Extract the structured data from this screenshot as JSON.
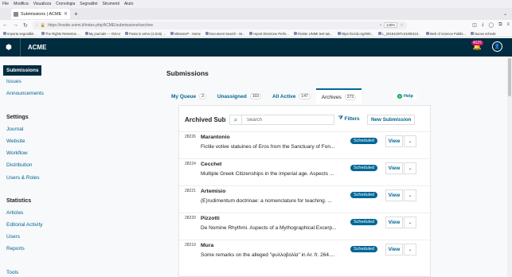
{
  "browser": {
    "menu": [
      "File",
      "Modifica",
      "Visualizza",
      "Cronologia",
      "Segnalibri",
      "Strumenti",
      "Aiuto"
    ],
    "tab_title": "Submissions | ACME",
    "url": "https://inside.unimi.it/index.php/ACME/submissions#archive",
    "zoom": "140%",
    "bookmarks": [
      "Importa segnalibri...",
      "The Rights Retention ...",
      "My journals — OOAJ",
      "Posta in arrivo (2.515) ...",
      "MilanoUP - Home",
      "Document Search - W...",
      "report Direzione Perfo...",
      "Riviste UNIMI test tas...",
      "https://orcid.org/000...",
      "L_2018119ITL01000110...",
      "Web of Science Publis...",
      "Nuove schede"
    ]
  },
  "header": {
    "context": "ACME",
    "notification_count": "4025"
  },
  "sidebar": {
    "submissions": "Submissions",
    "issues": "Issues",
    "announcements": "Announcements",
    "settings_head": "Settings",
    "journal": "Journal",
    "website": "Website",
    "workflow": "Workflow",
    "distribution": "Distribution",
    "users_roles": "Users & Roles",
    "statistics_head": "Statistics",
    "articles": "Articles",
    "editorial_activity": "Editorial Activity",
    "users": "Users",
    "reports": "Reports",
    "tools": "Tools"
  },
  "main": {
    "page_title": "Submissions",
    "tabs": [
      {
        "label": "My Queue",
        "count": "3"
      },
      {
        "label": "Unassigned",
        "count": "103"
      },
      {
        "label": "All Active",
        "count": "147"
      },
      {
        "label": "Archives",
        "count": "273"
      }
    ],
    "help_label": "Help",
    "list_title": "Archived Submissions",
    "search_placeholder": "Search",
    "filters_label": "Filters",
    "new_submission_label": "New Submission",
    "rows": [
      {
        "id": "28226",
        "author": "Marantonio",
        "title": "Fictile votive statuines of Eros from the Sanctuary of Fon...",
        "status": "Scheduled",
        "view": "View"
      },
      {
        "id": "28224",
        "author": "Cecchet",
        "title": "Multiple Greek Citizenships in the imperial age. Aspects ...",
        "status": "Scheduled",
        "view": "View"
      },
      {
        "id": "28221",
        "author": "Artemisio",
        "title": "(E)rudimentum doctrinae: a nomenclature for teaching. ...",
        "status": "Scheduled",
        "view": "View"
      },
      {
        "id": "28220",
        "author": "Pizzotti",
        "title": "De Nomine Rhythmi. Aspects of a Mythographical Excerp...",
        "status": "Scheduled",
        "view": "View"
      },
      {
        "id": "28219",
        "author": "Mura",
        "title": "Some remarks on the alleged \"φυλλοβολία\" in Ar. fr. 264....",
        "status": "Scheduled",
        "view": "View"
      }
    ]
  }
}
